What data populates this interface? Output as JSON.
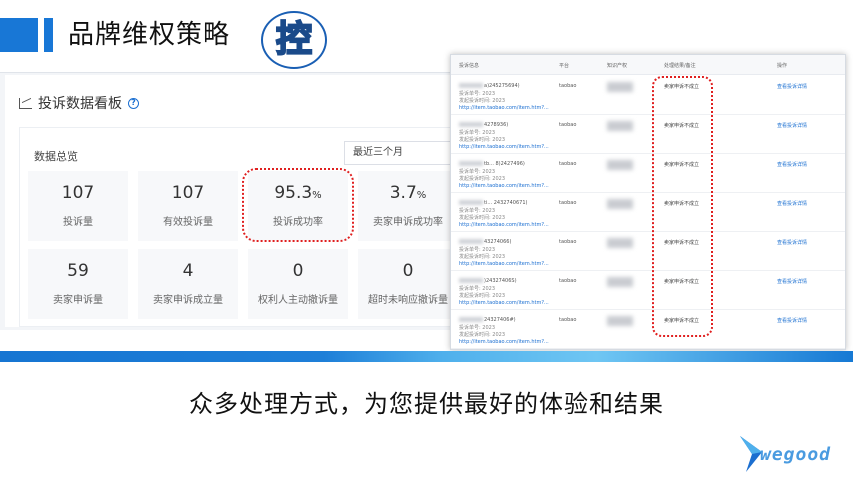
{
  "header": {
    "title": "品牌维权策略",
    "badge_char": "控"
  },
  "dashboard": {
    "title": "投诉数据看板",
    "overview_label": "数据总览",
    "period_select": "最近三个月",
    "cards": [
      {
        "value": "107",
        "unit": "",
        "label": "投诉量"
      },
      {
        "value": "107",
        "unit": "",
        "label": "有效投诉量"
      },
      {
        "value": "95.3",
        "unit": "%",
        "label": "投诉成功率"
      },
      {
        "value": "3.7",
        "unit": "%",
        "label": "卖家申诉成功率"
      },
      {
        "value": "59",
        "unit": "",
        "label": "卖家申诉量"
      },
      {
        "value": "4",
        "unit": "",
        "label": "卖家申诉成立量"
      },
      {
        "value": "0",
        "unit": "",
        "label": "权利人主动撤诉量"
      },
      {
        "value": "0",
        "unit": "",
        "label": "超时未响应撤诉量"
      }
    ]
  },
  "table": {
    "headers": [
      "投诉信息",
      "平台",
      "知识产权",
      "处理结果/备注",
      "操作"
    ],
    "rows": [
      {
        "id": "a)245275694)",
        "line2": "投诉单号: 2023",
        "line3": "发起投诉时间: 2023",
        "link": "http://item.taobao.com/item.htm?...",
        "platform": "taobao",
        "result": "卖家申诉不成立",
        "action": "查看投诉详情"
      },
      {
        "id": "4278936)",
        "line2": "投诉单号: 2023",
        "line3": "发起投诉时间: 2023",
        "link": "http://item.taobao.com/item.htm?...",
        "platform": "taobao",
        "result": "卖家申诉不成立",
        "action": "查看投诉详情"
      },
      {
        "id": "tb... 8)2427496)",
        "line2": "投诉单号: 2023",
        "line3": "发起投诉时间: 2023",
        "link": "http://item.taobao.com/item.htm?...",
        "platform": "taobao",
        "result": "卖家申诉不成立",
        "action": "查看投诉详情"
      },
      {
        "id": "ti... 2432740671)",
        "line2": "投诉单号: 2023",
        "line3": "发起投诉时间: 2023",
        "link": "http://item.taobao.com/item.htm?...",
        "platform": "taobao",
        "result": "卖家申诉不成立",
        "action": "查看投诉详情"
      },
      {
        "id": "43274066)",
        "line2": "投诉单号: 2023",
        "line3": "发起投诉时间: 2023",
        "link": "http://item.taobao.com/item.htm?...",
        "platform": "taobao",
        "result": "卖家申诉不成立",
        "action": "查看投诉详情"
      },
      {
        "id": ")24327406S)",
        "line2": "投诉单号: 2023",
        "line3": "发起投诉时间: 2023",
        "link": "http://item.taobao.com/item.htm?...",
        "platform": "taobao",
        "result": "卖家申诉不成立",
        "action": "查看投诉详情"
      },
      {
        "id": "24327406#)",
        "line2": "投诉单号: 2023",
        "line3": "发起投诉时间: 2023",
        "link": "http://item.taobao.com/item.htm?...",
        "platform": "taobao",
        "result": "卖家申诉不成立",
        "action": "查看投诉详情"
      }
    ]
  },
  "tagline": "众多处理方式，为您提供最好的体验和结果",
  "logo": {
    "text": "wegood",
    "color": "#4a9be0"
  },
  "colors": {
    "brand_blue": "#1877d6",
    "highlight_red": "#e02020",
    "link_blue": "#1b6fd1"
  }
}
